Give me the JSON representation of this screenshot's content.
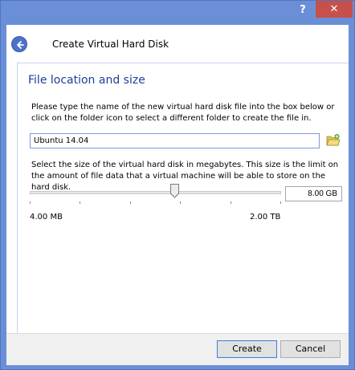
{
  "window": {
    "help_label": "?",
    "close_label": "✕"
  },
  "header": {
    "title": "Create Virtual Hard Disk"
  },
  "section": {
    "title": "File location and size",
    "location_text": "Please type the name of the new virtual hard disk file into the box below or click on the folder icon to select a different folder to create the file in.",
    "file_name": "Ubuntu 14.04",
    "size_text": "Select the size of the virtual hard disk in megabytes. This size is the limit on the amount of file data that a virtual machine will be able to store on the hard disk.",
    "size_value": "8.00 GB",
    "range_min": "4.00 MB",
    "range_max": "2.00 TB",
    "slider_fraction": 0.575
  },
  "footer": {
    "create_label": "Create",
    "cancel_label": "Cancel"
  },
  "colors": {
    "frame": "#6b8fd6",
    "title_accent": "#1e3f99",
    "close": "#c7504a"
  }
}
